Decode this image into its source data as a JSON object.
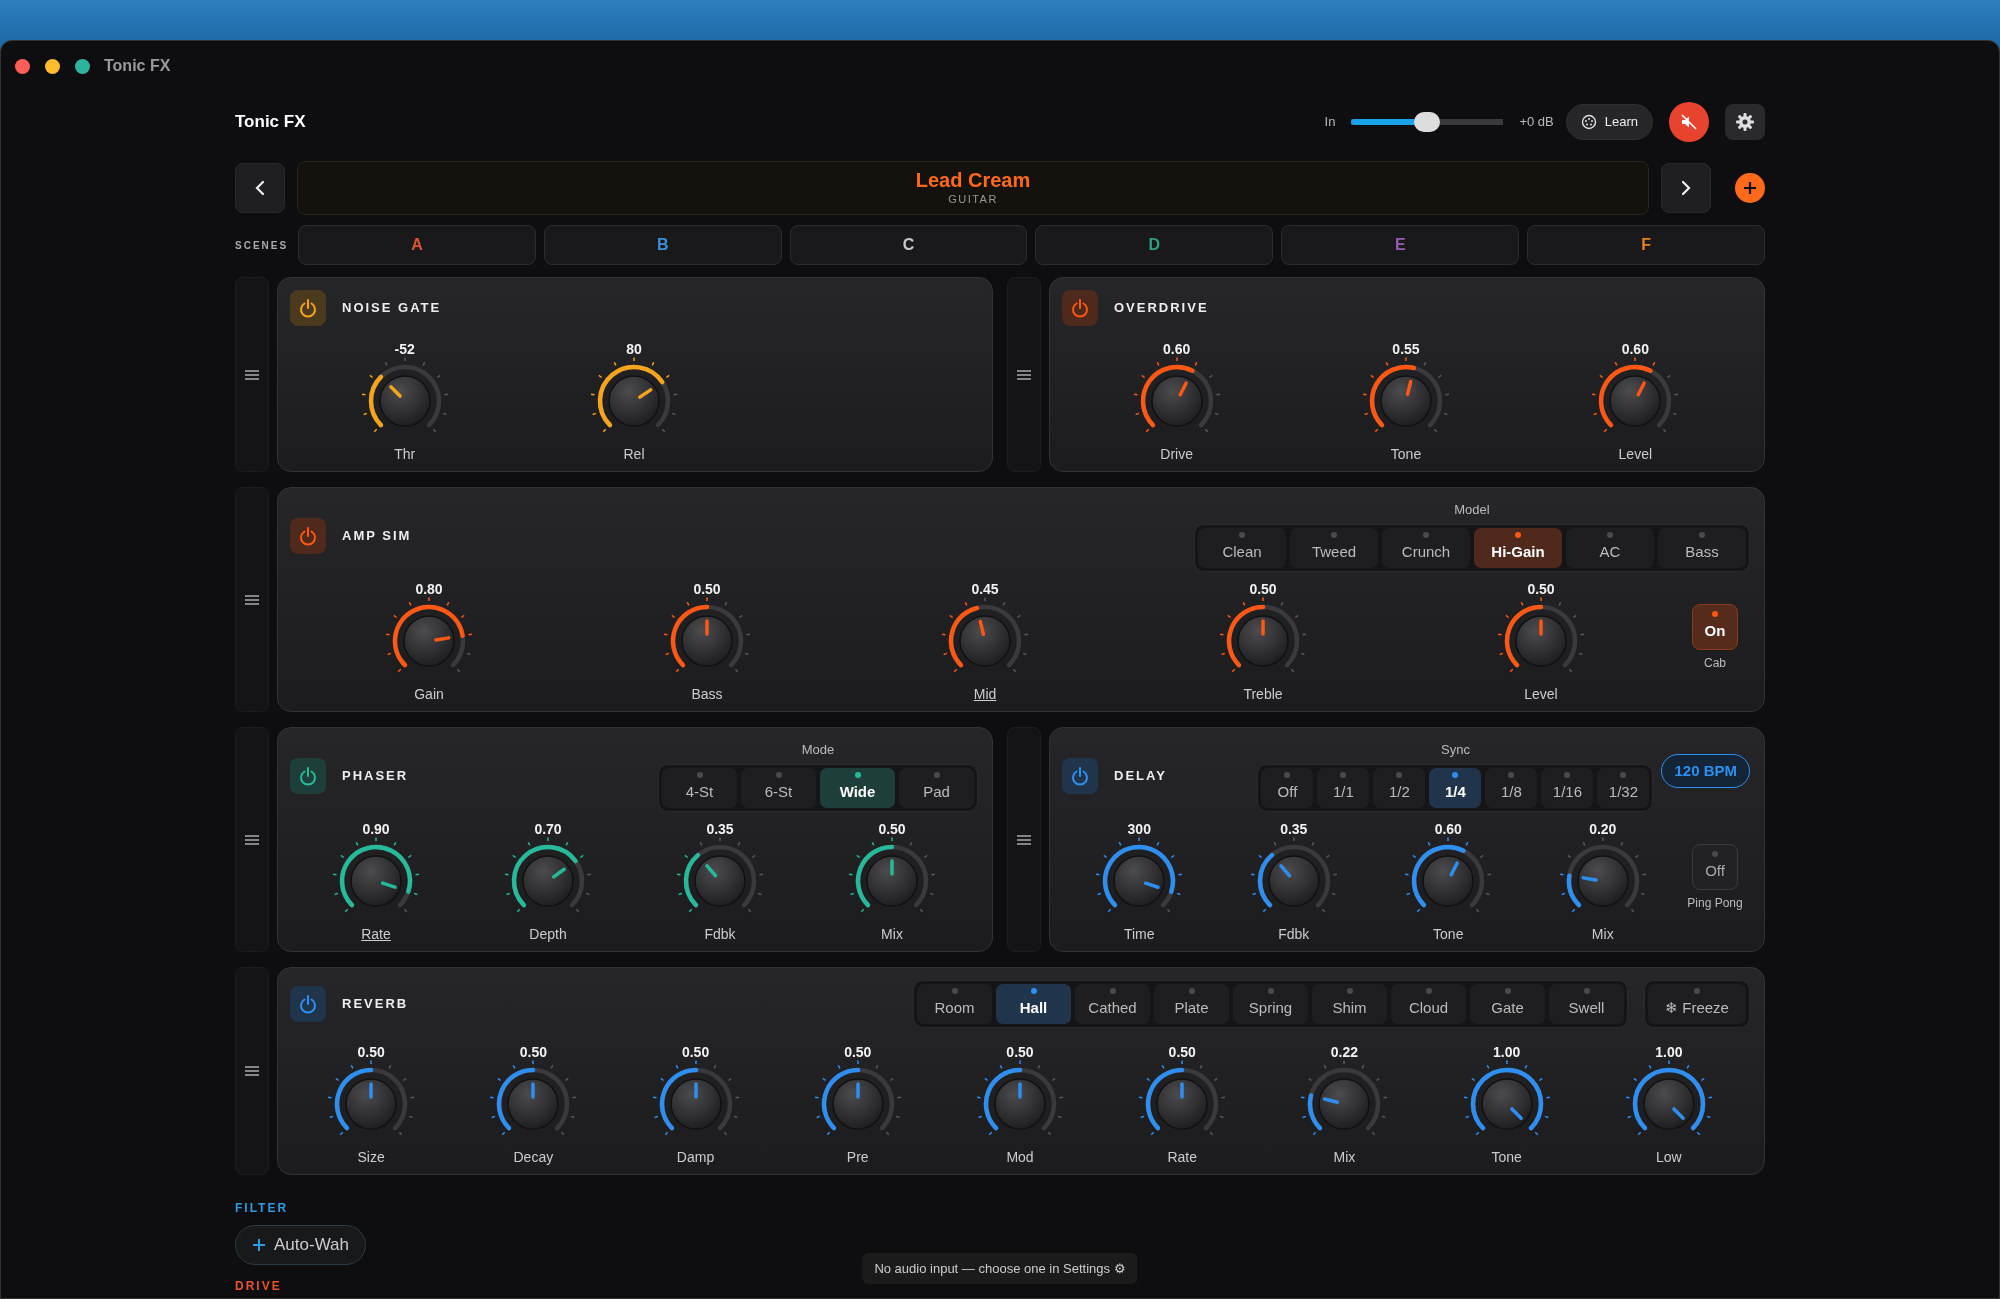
{
  "window": {
    "title": "Tonic FX"
  },
  "header": {
    "title": "Tonic FX",
    "input": {
      "label": "In",
      "level": 0.5,
      "reading": "+0 dB"
    },
    "learn": "Learn",
    "muted": true
  },
  "preset": {
    "name": "Lead Cream",
    "category": "GUITAR"
  },
  "scenes": {
    "label": "SCENES",
    "items": [
      {
        "label": "A",
        "color": "#d9552b",
        "selected": false
      },
      {
        "label": "B",
        "color": "#3a8fd6",
        "selected": false
      },
      {
        "label": "C",
        "color": "#c8c8c8",
        "selected": false
      },
      {
        "label": "D",
        "color": "#2f9e86",
        "selected": false
      },
      {
        "label": "E",
        "color": "#9b59b6",
        "selected": false
      },
      {
        "label": "F",
        "color": "#e67e22",
        "selected": false
      }
    ]
  },
  "rows": [
    {
      "modules": [
        {
          "title": "NOISE GATE",
          "color": "#f4a51c",
          "on": true,
          "knobs": [
            {
              "value": "-52",
              "label": "Thr",
              "midi_mapped": false
            },
            {
              "value": "80",
              "label": "Rel",
              "midi_mapped": false
            }
          ]
        },
        {
          "title": "OVERDRIVE",
          "color": "#ff5714",
          "on": true,
          "knobs": [
            {
              "value": "0.60",
              "label": "Drive",
              "midi_mapped": false
            },
            {
              "value": "0.55",
              "label": "Tone",
              "midi_mapped": false
            },
            {
              "value": "0.60",
              "label": "Level",
              "midi_mapped": false
            }
          ]
        }
      ]
    },
    {
      "modules": [
        {
          "title": "AMP SIM",
          "color": "#ff5714",
          "on": true,
          "selector": {
            "label": "Model",
            "options": [
              {
                "label": "Clean",
                "selected": false
              },
              {
                "label": "Tweed",
                "selected": false
              },
              {
                "label": "Crunch",
                "selected": false
              },
              {
                "label": "Hi-Gain",
                "selected": true
              },
              {
                "label": "AC",
                "selected": false
              },
              {
                "label": "Bass",
                "selected": false
              }
            ]
          },
          "toggle": {
            "label": "On",
            "caption": "Cab",
            "on": true
          },
          "knobs": [
            {
              "value": "0.80",
              "label": "Gain",
              "midi_mapped": false
            },
            {
              "value": "0.50",
              "label": "Bass",
              "midi_mapped": false
            },
            {
              "value": "0.45",
              "label": "Mid",
              "midi_mapped": true
            },
            {
              "value": "0.50",
              "label": "Treble",
              "midi_mapped": false
            },
            {
              "value": "0.50",
              "label": "Level",
              "midi_mapped": false
            }
          ]
        }
      ]
    },
    {
      "modules": [
        {
          "title": "PHASER",
          "color": "#26b99a",
          "on": true,
          "selector": {
            "label": "Mode",
            "options": [
              {
                "label": "4-St",
                "selected": false
              },
              {
                "label": "6-St",
                "selected": false
              },
              {
                "label": "Wide",
                "selected": true
              },
              {
                "label": "Pad",
                "selected": false
              }
            ]
          },
          "knobs": [
            {
              "value": "0.90",
              "label": "Rate",
              "midi_mapped": true
            },
            {
              "value": "0.70",
              "label": "Depth",
              "midi_mapped": false
            },
            {
              "value": "0.35",
              "label": "Fdbk",
              "midi_mapped": false
            },
            {
              "value": "0.50",
              "label": "Mix",
              "midi_mapped": false
            }
          ]
        },
        {
          "title": "DELAY",
          "color": "#2f8ff0",
          "on": true,
          "selector": {
            "label": "Sync",
            "options": [
              {
                "label": "Off",
                "selected": false
              },
              {
                "label": "1/1",
                "selected": false
              },
              {
                "label": "1/2",
                "selected": false
              },
              {
                "label": "1/4",
                "selected": true
              },
              {
                "label": "1/8",
                "selected": false
              },
              {
                "label": "1/16",
                "selected": false
              },
              {
                "label": "1/32",
                "selected": false
              }
            ]
          },
          "tempo": "120 BPM",
          "toggle": {
            "label": "Off",
            "caption": "Ping Pong",
            "on": false
          },
          "knobs": [
            {
              "value": "300",
              "label": "Time",
              "midi_mapped": false
            },
            {
              "value": "0.35",
              "label": "Fdbk",
              "midi_mapped": false
            },
            {
              "value": "0.60",
              "label": "Tone",
              "midi_mapped": false
            },
            {
              "value": "0.20",
              "label": "Mix",
              "midi_mapped": false
            }
          ]
        }
      ]
    },
    {
      "modules": [
        {
          "title": "REVERB",
          "color": "#2f8ff0",
          "on": true,
          "selector": {
            "options": [
              {
                "label": "Room",
                "selected": false
              },
              {
                "label": "Hall",
                "selected": true
              },
              {
                "label": "Cathed",
                "selected": false
              },
              {
                "label": "Plate",
                "selected": false
              },
              {
                "label": "Spring",
                "selected": false
              },
              {
                "label": "Shim",
                "selected": false
              },
              {
                "label": "Cloud",
                "selected": false
              },
              {
                "label": "Gate",
                "selected": false
              },
              {
                "label": "Swell",
                "selected": false
              }
            ]
          },
          "header_toggle": {
            "label": "❄ Freeze",
            "on": false
          },
          "knobs": [
            {
              "value": "0.50",
              "label": "Size",
              "midi_mapped": false
            },
            {
              "value": "0.50",
              "label": "Decay",
              "midi_mapped": false
            },
            {
              "value": "0.50",
              "label": "Damp",
              "midi_mapped": false
            },
            {
              "value": "0.50",
              "label": "Pre",
              "midi_mapped": false
            },
            {
              "value": "0.50",
              "label": "Mod",
              "midi_mapped": false
            },
            {
              "value": "0.50",
              "label": "Rate",
              "midi_mapped": false
            },
            {
              "value": "0.22",
              "label": "Mix",
              "midi_mapped": false
            },
            {
              "value": "1.00",
              "label": "Tone",
              "midi_mapped": false
            },
            {
              "value": "1.00",
              "label": "Low",
              "midi_mapped": false
            }
          ]
        }
      ]
    }
  ],
  "library": [
    {
      "title": "FILTER",
      "color": "#2f9be0",
      "items": [
        {
          "label": "Auto-Wah"
        }
      ]
    },
    {
      "title": "DRIVE",
      "color": "#e8542a"
    }
  ],
  "status": "No audio input — choose one in Settings ⚙"
}
